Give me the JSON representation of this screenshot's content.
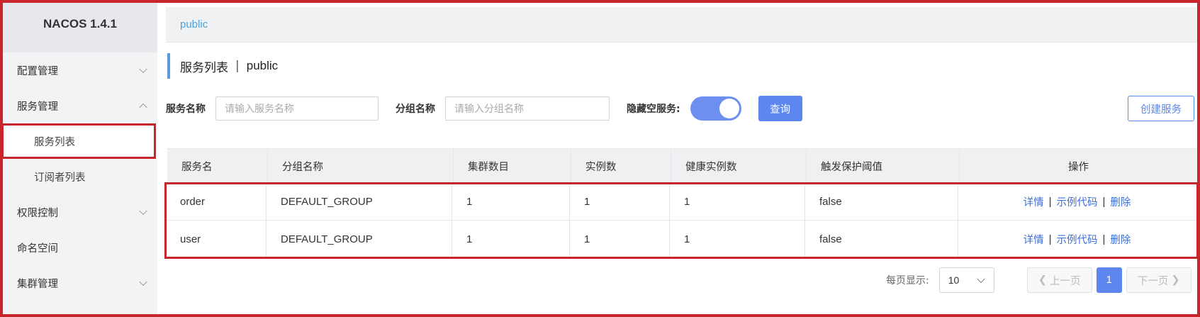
{
  "app": {
    "brand": "NACOS 1.4.1"
  },
  "sidebar": {
    "items": [
      {
        "label": "配置管理",
        "chevron": "down"
      },
      {
        "label": "服务管理",
        "chevron": "up"
      },
      {
        "label": "服务列表",
        "sub": true,
        "active": true
      },
      {
        "label": "订阅者列表",
        "sub": true
      },
      {
        "label": "权限控制",
        "chevron": "down"
      },
      {
        "label": "命名空间"
      },
      {
        "label": "集群管理",
        "chevron": "down"
      }
    ]
  },
  "topbar": {
    "namespace": "public"
  },
  "page": {
    "title": "服务列表",
    "separator": "|",
    "namespace": "public"
  },
  "filters": {
    "service_label": "服务名称",
    "service_placeholder": "请输入服务名称",
    "group_label": "分组名称",
    "group_placeholder": "请输入分组名称",
    "hide_empty_label": "隐藏空服务:",
    "hide_empty_on": true,
    "query_button": "查询",
    "create_button": "创建服务"
  },
  "table": {
    "columns": [
      "服务名",
      "分组名称",
      "集群数目",
      "实例数",
      "健康实例数",
      "触发保护阈值",
      "操作"
    ],
    "rows": [
      {
        "name": "order",
        "group": "DEFAULT_GROUP",
        "clusters": "1",
        "instances": "1",
        "healthy": "1",
        "threshold": "false"
      },
      {
        "name": "user",
        "group": "DEFAULT_GROUP",
        "clusters": "1",
        "instances": "1",
        "healthy": "1",
        "threshold": "false"
      }
    ],
    "actions": {
      "detail": "详情",
      "sample": "示例代码",
      "delete": "删除",
      "separator": "|"
    }
  },
  "pagination": {
    "per_page_label": "每页显示:",
    "per_page_value": "10",
    "prev": "上一页",
    "next": "下一页",
    "current": "1"
  },
  "colors": {
    "accent": "#5d86ee",
    "highlight": "#c9252c",
    "link": "#3d6fd6"
  }
}
